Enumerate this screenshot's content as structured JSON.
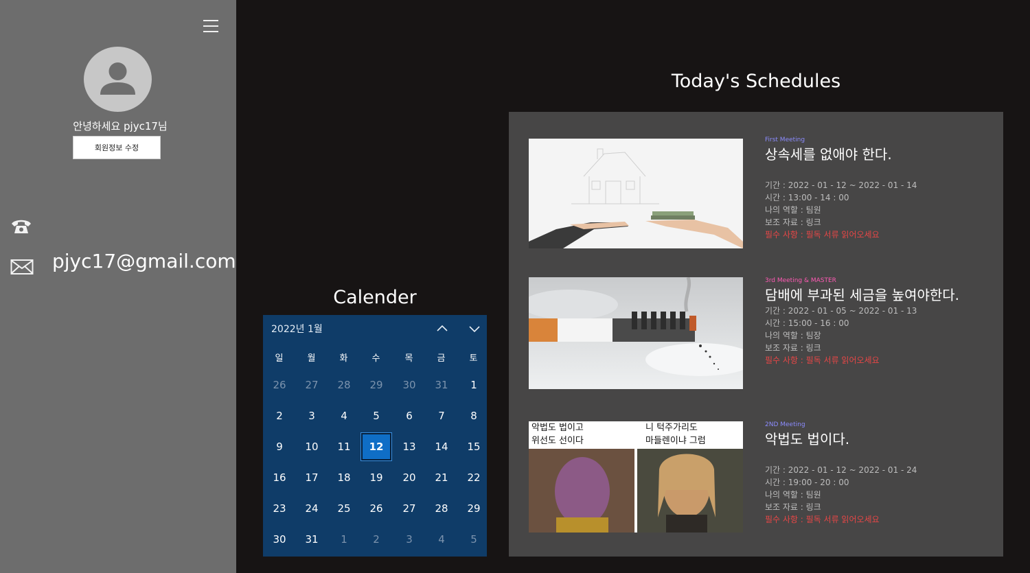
{
  "sidebar": {
    "greeting": "안녕하세요 pjyc17님",
    "edit_button": "회원정보 수정",
    "email": "pjyc17@gmail.com"
  },
  "calendar": {
    "title": "Calender",
    "month_label": "2022년 1월",
    "weekdays": [
      "일",
      "월",
      "화",
      "수",
      "목",
      "금",
      "토"
    ],
    "weeks": [
      [
        "26",
        "27",
        "28",
        "29",
        "30",
        "31",
        "1"
      ],
      [
        "2",
        "3",
        "4",
        "5",
        "6",
        "7",
        "8"
      ],
      [
        "9",
        "10",
        "11",
        "12",
        "13",
        "14",
        "15"
      ],
      [
        "16",
        "17",
        "18",
        "19",
        "20",
        "21",
        "22"
      ],
      [
        "23",
        "24",
        "25",
        "26",
        "27",
        "28",
        "29"
      ],
      [
        "30",
        "31",
        "1",
        "2",
        "3",
        "4",
        "5"
      ]
    ],
    "selected_day": "12"
  },
  "schedules": {
    "title": "Today's Schedules",
    "items": [
      {
        "tag": "First Meeting",
        "tag_color": "#8c8cff",
        "heading": "상속세를 없애야 한다.",
        "period": "기간 : 2022 - 01 - 12 ~ 2022 - 01 - 14",
        "time": "시간 : 13:00 - 14 : 00",
        "role": "나의 역할 : 팀원",
        "material": "보조 자료 : 링크",
        "required": "필수 사항 : 필독 서류 읽어오세요"
      },
      {
        "tag": "3rd Meeting & MASTER",
        "tag_color": "#ff5ab4",
        "heading": "담배에 부과된 세금을 높여야한다.",
        "period": "기간 : 2022 - 01 - 05 ~ 2022 - 01 - 13",
        "time": "시간 : 15:00 - 16 : 00",
        "role": "나의 역할 : 팀장",
        "material": "보조 자료 : 링크",
        "required": "필수 사항 : 필독 서류 읽어오세요"
      },
      {
        "tag": "2ND Meeting",
        "tag_color": "#8c8cff",
        "heading": "악법도 법이다.",
        "period": "기간 : 2022 - 01 - 12 ~ 2022 - 01 - 24",
        "time": "시간 : 19:00 - 20 : 00",
        "role": "나의 역할 : 팀원",
        "material": "보조 자료 : 링크",
        "required": "필수 사항 : 필독 서류 읽어오세요",
        "image_captions": [
          "악법도 법이고",
          "위선도 선이다",
          "니 턱주가리도",
          "마들렌이냐 그럼"
        ]
      }
    ]
  }
}
